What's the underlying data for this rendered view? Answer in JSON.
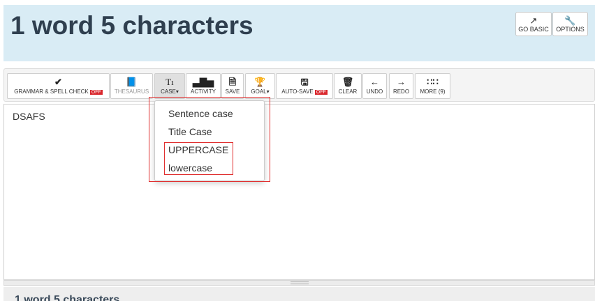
{
  "header": {
    "title": "1 word 5 characters",
    "go_basic": "GO BASIC",
    "options": "OPTIONS"
  },
  "toolbar": {
    "grammar": "GRAMMAR & SPELL CHECK",
    "grammar_state": "OFF",
    "thesaurus": "THESAURUS",
    "case": "CASE",
    "activity": "ACTIVITY",
    "save": "SAVE",
    "goal": "GOAL",
    "autosave": "AUTO-SAVE",
    "autosave_state": "OFF",
    "clear": "CLEAR",
    "undo": "UNDO",
    "redo": "REDO",
    "more": "MORE (9)"
  },
  "editor": {
    "text": "DSAFS"
  },
  "case_menu": {
    "items": [
      "Sentence case",
      "Title Case",
      "UPPERCASE",
      "lowercase"
    ]
  },
  "footer": {
    "title": "1 word 5 characters"
  },
  "icons": {
    "external": "external-link-icon",
    "wrench": "wrench-icon",
    "check": "checkmark-icon",
    "book": "book-icon",
    "case": "text-case-icon",
    "chart": "bar-chart-icon",
    "save": "save-file-icon",
    "trophy": "trophy-icon",
    "floppy": "floppy-disk-icon",
    "trash": "trash-icon",
    "undo": "arrow-left-icon",
    "redo": "arrow-right-icon",
    "grid": "grid-icon"
  },
  "colors": {
    "header_bg": "#d9ecf5",
    "off_badge": "#d9262c",
    "highlight": "#e03030"
  }
}
